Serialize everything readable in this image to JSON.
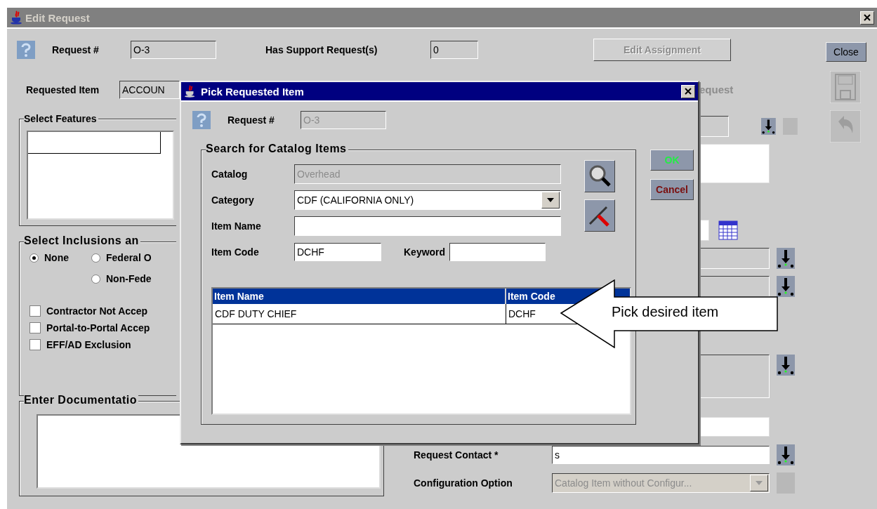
{
  "window": {
    "title": "Edit Request"
  },
  "header": {
    "request_label": "Request #",
    "request_value": "O-3",
    "support_label": "Has Support Request(s)",
    "support_value": "0",
    "edit_assignment": {
      "label": "Edit Assignment",
      "disabled": true
    },
    "close_label": "Close"
  },
  "requested_item": {
    "label": "Requested Item",
    "value": "ACCOUN"
  },
  "features": {
    "title": "Select Features"
  },
  "inclusions": {
    "title": "Select Inclusions an",
    "radios": [
      {
        "label": "None",
        "selected": true
      },
      {
        "label": "Federal O",
        "selected": false
      },
      {
        "label": "Non-Fede",
        "selected": false
      }
    ],
    "checkboxes": [
      {
        "label": "Contractor Not Accep",
        "checked": false
      },
      {
        "label": "Portal-to-Portal Accep",
        "checked": false
      },
      {
        "label": "EFF/AD Exclusion",
        "checked": false
      }
    ]
  },
  "documentation": {
    "title": "Enter Documentatio"
  },
  "right_panel": {
    "partial_label": "equest"
  },
  "contact": {
    "label": "Request Contact *",
    "value": "s"
  },
  "configuration": {
    "label": "Configuration Option",
    "value": "Catalog Item without Configur...",
    "disabled": true
  },
  "dialog": {
    "title": "Pick Requested Item",
    "request_label": "Request #",
    "request_value": "O-3",
    "group_title": "Search for Catalog Items",
    "catalog": {
      "label": "Catalog",
      "value": "Overhead",
      "disabled": true
    },
    "category": {
      "label": "Category",
      "value": "CDF (CALIFORNIA ONLY)"
    },
    "item_name": {
      "label": "Item Name"
    },
    "item_code": {
      "label": "Item Code",
      "value": "DCHF"
    },
    "keyword": {
      "label": "Keyword"
    },
    "table": {
      "columns": [
        "Item Name",
        "Item Code"
      ],
      "rows": [
        {
          "cells": [
            "CDF DUTY CHIEF",
            "DCHF"
          ],
          "selected": false
        }
      ]
    },
    "buttons": [
      {
        "label": "OK",
        "kind": "ok"
      },
      {
        "label": "Cancel",
        "kind": "cancel"
      }
    ]
  },
  "callout": {
    "text": "Pick desired item"
  }
}
